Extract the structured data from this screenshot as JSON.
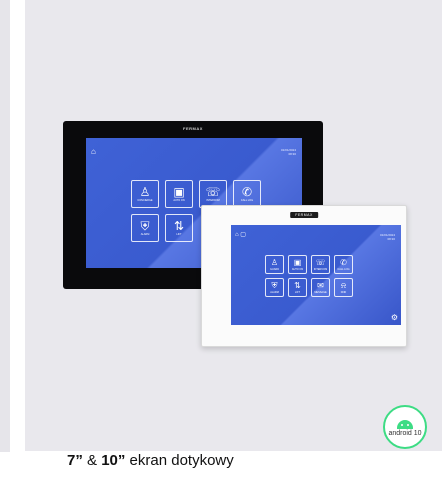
{
  "brand": "FERMAX",
  "monitor_10": {
    "datetime": [
      "01/01/2024",
      "08:30"
    ],
    "tiles": [
      {
        "label": "CONCIERGE",
        "icon": "concierge-icon",
        "glyph": "♙"
      },
      {
        "label": "AUTO ON",
        "icon": "auto-on-icon",
        "glyph": "▣"
      },
      {
        "label": "INTERCOM",
        "icon": "intercom-icon",
        "glyph": "☏"
      },
      {
        "label": "CALL LOG",
        "icon": "call-log-icon",
        "glyph": "✆"
      },
      {
        "label": "ALARM",
        "icon": "alarm-shield-icon",
        "glyph": "⛨"
      },
      {
        "label": "LIFT",
        "icon": "lift-icon",
        "glyph": "⇅"
      }
    ]
  },
  "monitor_7": {
    "datetime": [
      "01/01/2024",
      "08:30"
    ],
    "tiles": [
      {
        "label": "GUARD",
        "icon": "guard-icon",
        "glyph": "♙"
      },
      {
        "label": "AUTO ON",
        "icon": "auto-on-icon",
        "glyph": "▣"
      },
      {
        "label": "INTERCOM",
        "icon": "intercom-icon",
        "glyph": "☏"
      },
      {
        "label": "CALL LOG",
        "icon": "call-log-icon",
        "glyph": "✆"
      },
      {
        "label": "ALARM",
        "icon": "alarm-shield-icon",
        "glyph": "⛨"
      },
      {
        "label": "LIFT",
        "icon": "lift-icon",
        "glyph": "⇅"
      },
      {
        "label": "MESSAGE",
        "icon": "message-icon",
        "glyph": "✉"
      },
      {
        "label": "DND",
        "icon": "dnd-bell-icon",
        "glyph": "⍾"
      }
    ]
  },
  "android_badge": {
    "text": "android 10"
  },
  "caption": {
    "size_a": "7”",
    "amp": " & ",
    "size_b": "10”",
    "text": " ekran dotykowy"
  },
  "colors": {
    "card": "#e9e8ed",
    "screen": "#3f62d6",
    "android": "#3ddc84"
  }
}
